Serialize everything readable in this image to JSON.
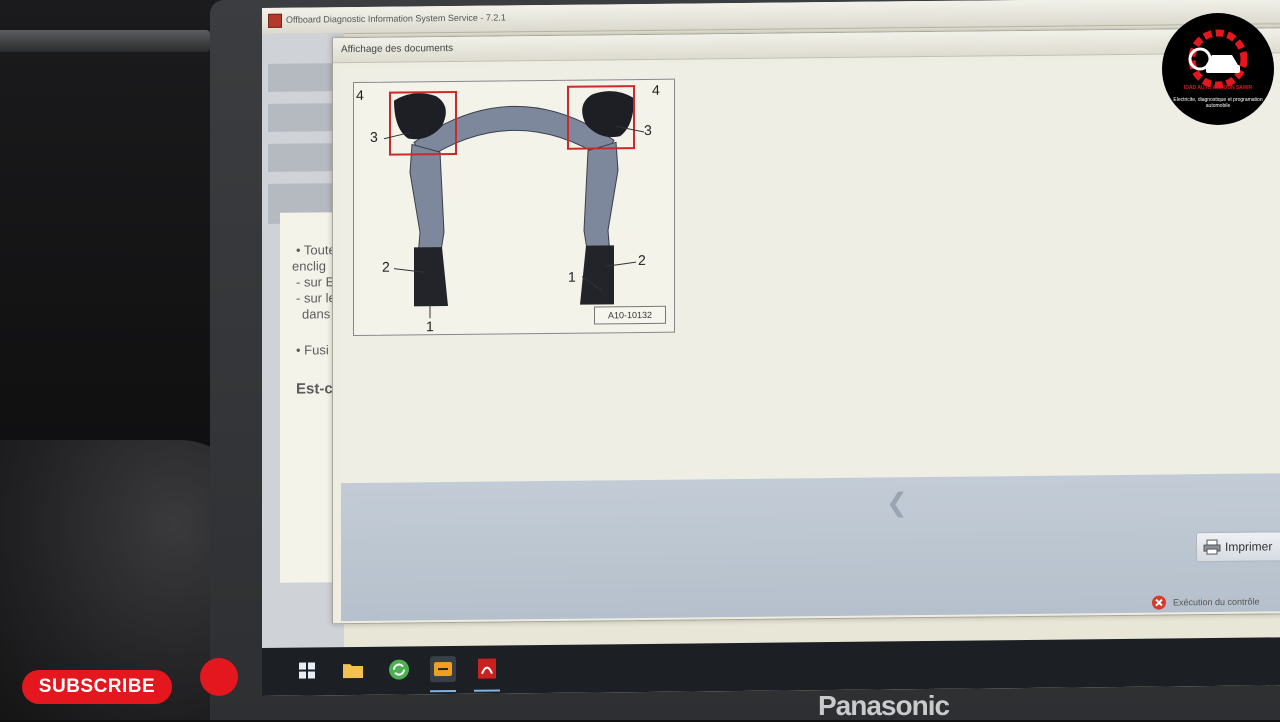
{
  "window": {
    "app_title": "Offboard Diagnostic Information System Service - 7.2.1"
  },
  "background_panel": {
    "bullet_1_lines": [
      "• Toute",
      "enclig",
      "- sur El",
      "- sur le",
      "dans l"
    ],
    "bullet_2": "• Fusi",
    "question": "Est-c"
  },
  "document_window": {
    "title": "Affichage des documents",
    "figure_id": "A10-10132",
    "callouts": {
      "left_top": "4",
      "left_mid": "3",
      "left_lower": "2",
      "left_bottom": "1",
      "right_top": "4",
      "right_mid": "3",
      "right_lower": "2",
      "right_bottom": "1"
    },
    "print_label": "Imprimer",
    "status_label": "Exécution du contrôle"
  },
  "taskbar": {
    "icons": [
      "windows-start-icon",
      "file-explorer-icon",
      "refresh-app-icon",
      "odis-app-icon",
      "pdf-reader-icon"
    ]
  },
  "hardware": {
    "brand": "Panasonic"
  },
  "overlay": {
    "subscribe_label": "SUBSCRIBE",
    "logo_name": "IDAD AUTO AKROUN SAMIR",
    "logo_tagline": "Electricite, diagnostique et programation automobile"
  },
  "colors": {
    "subscribe_red": "#e5171e",
    "highlight_red": "#cc2a2a",
    "subframe_blue": "#7d889c"
  }
}
